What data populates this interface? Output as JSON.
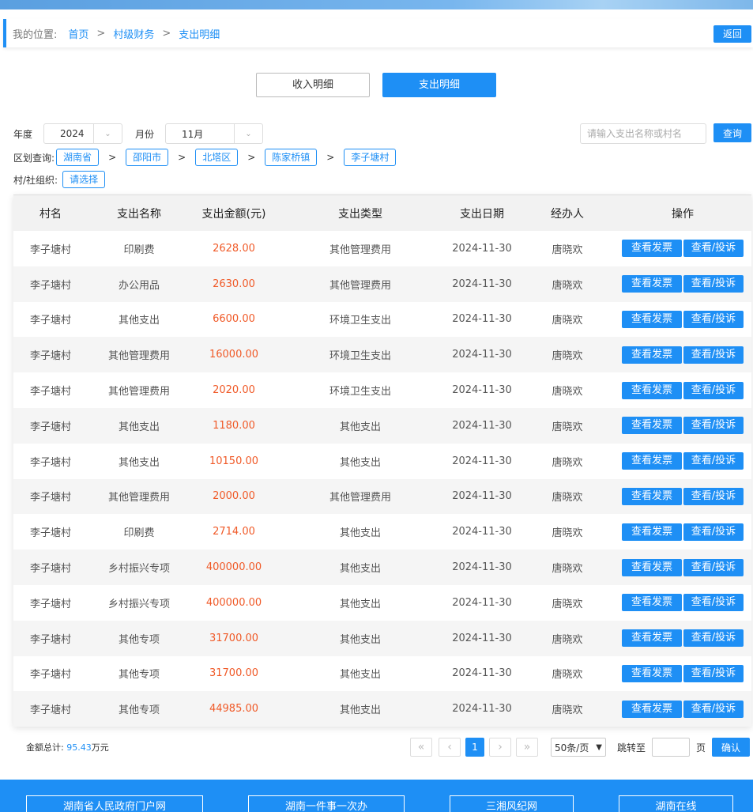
{
  "breadcrumb": {
    "prefix": "我的位置:",
    "items": [
      "首页",
      "村级财务",
      "支出明细"
    ],
    "separator": ">",
    "back_label": "返回"
  },
  "tabs": [
    {
      "label": "收入明细",
      "active": false
    },
    {
      "label": "支出明细",
      "active": true
    }
  ],
  "filters": {
    "year_label": "年度",
    "year_value": "2024",
    "month_label": "月份",
    "month_value": "11月",
    "search_placeholder": "请输入支出名称或村名",
    "query_label": "查询",
    "region_label": "区划查询:",
    "regions": [
      "湖南省",
      "邵阳市",
      "北塔区",
      "陈家桥镇",
      "李子塘村"
    ],
    "region_separator": ">",
    "org_label": "村/社组织:",
    "org_placeholder": "请选择"
  },
  "table": {
    "headers": [
      "村名",
      "支出名称",
      "支出金额(元)",
      "支出类型",
      "支出日期",
      "经办人",
      "操作"
    ],
    "action_invoice": "查看发票",
    "action_complaint": "查看/投诉",
    "rows": [
      {
        "village": "李子塘村",
        "name": "印刷费",
        "amount": "2628.00",
        "type": "其他管理费用",
        "date": "2024-11-30",
        "handler": "唐晓欢"
      },
      {
        "village": "李子塘村",
        "name": "办公用品",
        "amount": "2630.00",
        "type": "其他管理费用",
        "date": "2024-11-30",
        "handler": "唐晓欢"
      },
      {
        "village": "李子塘村",
        "name": "其他支出",
        "amount": "6600.00",
        "type": "环境卫生支出",
        "date": "2024-11-30",
        "handler": "唐晓欢"
      },
      {
        "village": "李子塘村",
        "name": "其他管理费用",
        "amount": "16000.00",
        "type": "环境卫生支出",
        "date": "2024-11-30",
        "handler": "唐晓欢"
      },
      {
        "village": "李子塘村",
        "name": "其他管理费用",
        "amount": "2020.00",
        "type": "环境卫生支出",
        "date": "2024-11-30",
        "handler": "唐晓欢"
      },
      {
        "village": "李子塘村",
        "name": "其他支出",
        "amount": "1180.00",
        "type": "其他支出",
        "date": "2024-11-30",
        "handler": "唐晓欢"
      },
      {
        "village": "李子塘村",
        "name": "其他支出",
        "amount": "10150.00",
        "type": "其他支出",
        "date": "2024-11-30",
        "handler": "唐晓欢"
      },
      {
        "village": "李子塘村",
        "name": "其他管理费用",
        "amount": "2000.00",
        "type": "其他管理费用",
        "date": "2024-11-30",
        "handler": "唐晓欢"
      },
      {
        "village": "李子塘村",
        "name": "印刷费",
        "amount": "2714.00",
        "type": "其他支出",
        "date": "2024-11-30",
        "handler": "唐晓欢"
      },
      {
        "village": "李子塘村",
        "name": "乡村振兴专项",
        "amount": "400000.00",
        "type": "其他支出",
        "date": "2024-11-30",
        "handler": "唐晓欢"
      },
      {
        "village": "李子塘村",
        "name": "乡村振兴专项",
        "amount": "400000.00",
        "type": "其他支出",
        "date": "2024-11-30",
        "handler": "唐晓欢"
      },
      {
        "village": "李子塘村",
        "name": "其他专项",
        "amount": "31700.00",
        "type": "其他支出",
        "date": "2024-11-30",
        "handler": "唐晓欢"
      },
      {
        "village": "李子塘村",
        "name": "其他专项",
        "amount": "31700.00",
        "type": "其他支出",
        "date": "2024-11-30",
        "handler": "唐晓欢"
      },
      {
        "village": "李子塘村",
        "name": "其他专项",
        "amount": "44985.00",
        "type": "其他支出",
        "date": "2024-11-30",
        "handler": "唐晓欢"
      }
    ]
  },
  "summary": {
    "label": "金额总计:",
    "value": "95.43",
    "unit": "万元"
  },
  "pagination": {
    "first": "«",
    "prev": "‹",
    "current": "1",
    "next": "›",
    "last": "»",
    "page_size": "50条/页",
    "jump_label": "跳转至",
    "page_unit": "页",
    "confirm_label": "确认"
  },
  "footer": {
    "links": [
      "湖南省人民政府门户网",
      "湖南一件事一次办",
      "三湘风纪网",
      "湖南在线"
    ]
  },
  "colors": {
    "primary": "#1e8ff5",
    "amount": "#f05a28"
  }
}
